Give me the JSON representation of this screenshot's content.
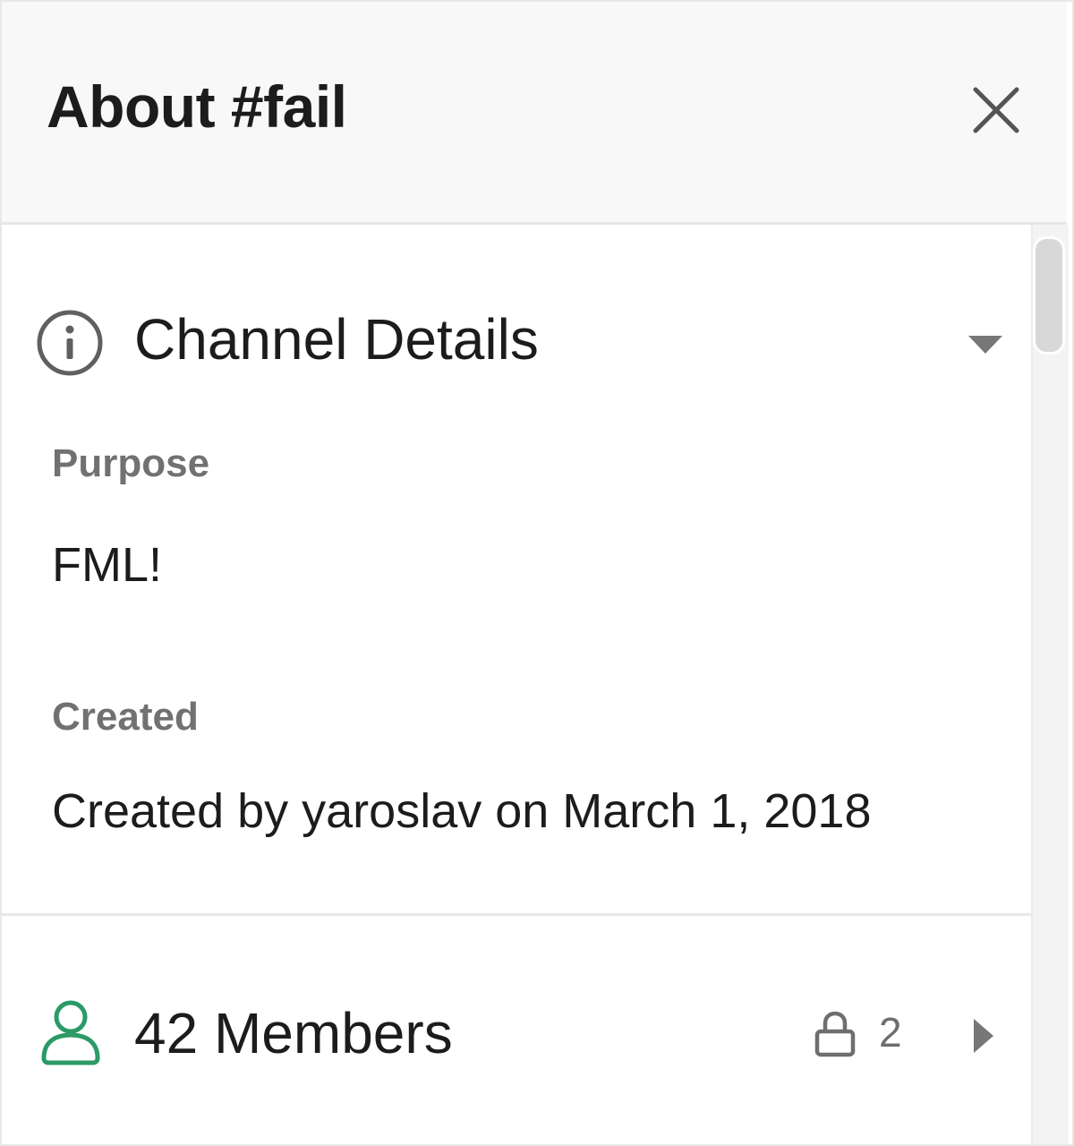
{
  "header": {
    "title": "About #fail",
    "close_icon": "close-icon"
  },
  "channel_details": {
    "title": "Channel Details",
    "icon": "info-icon",
    "expanded": true,
    "purpose": {
      "label": "Purpose",
      "value": "FML!"
    },
    "created": {
      "label": "Created",
      "value": "Created by yaroslav on March 1, 2018"
    }
  },
  "members": {
    "label": "42 Members",
    "icon": "person-icon",
    "private_count": "2",
    "private_icon": "lock-icon",
    "accent_color": "#2b9a66"
  },
  "colors": {
    "header_bg": "#f8f8f8",
    "text_primary": "#1d1c1d",
    "text_secondary": "#717171"
  }
}
